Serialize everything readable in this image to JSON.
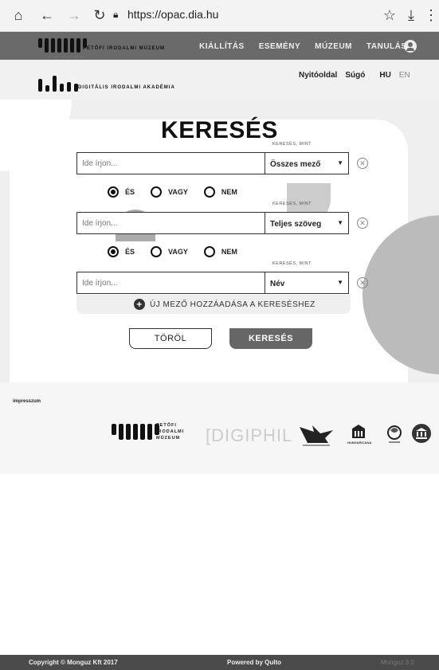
{
  "browser": {
    "url": "https://opac.dia.hu",
    "icons": [
      "home-icon",
      "back-icon",
      "forward-icon",
      "reload-icon",
      "lock-icon",
      "star-icon",
      "download-icon",
      "menu-icon"
    ]
  },
  "header": {
    "logo_text": "PETŐFI IRODALMI MÚZEUM",
    "nav": [
      "KIÁLLÍTÁS",
      "ESEMÉNY",
      "MÚZEUM",
      "TANULÁS"
    ],
    "sub_logo_text": "DIGITÁLIS IRODALMI AKADÉMIA",
    "sublinks": {
      "home": "Nyitóoldal",
      "help": "Súgó",
      "hu": "HU",
      "en": "EN"
    }
  },
  "search": {
    "title": "KERESÉS",
    "mode_label": "KERESÉS, MINT",
    "fields": [
      {
        "placeholder": "Ide írjon...",
        "type": "Összes mező"
      },
      {
        "placeholder": "Ide írjon...",
        "type": "Teljes szöveg"
      },
      {
        "placeholder": "Ide írjon...",
        "type": "Név"
      }
    ],
    "operators": [
      {
        "options": [
          "ÉS",
          "VAGY",
          "NEM"
        ],
        "selected": "ÉS"
      },
      {
        "options": [
          "ÉS",
          "VAGY",
          "NEM"
        ],
        "selected": "ÉS"
      }
    ],
    "add_field": "ÚJ MEZŐ HOZZÁADÁSA A KERESÉSHEZ",
    "clear_button": "TÖRÖL",
    "search_button": "KERESÉS"
  },
  "footer": {
    "impresszum": "impresszum",
    "pim_lines": [
      "PETŐFI",
      "IRODALMI",
      "MÚZEUM"
    ],
    "digiphil": "[DIGIPHIL",
    "hungaricana": "HUNGARICANA"
  },
  "bottom": {
    "copyright": "Copyright © Monguz Kft 2017",
    "powered": "Powered by Qulto",
    "version": "Monguz 3.0"
  }
}
